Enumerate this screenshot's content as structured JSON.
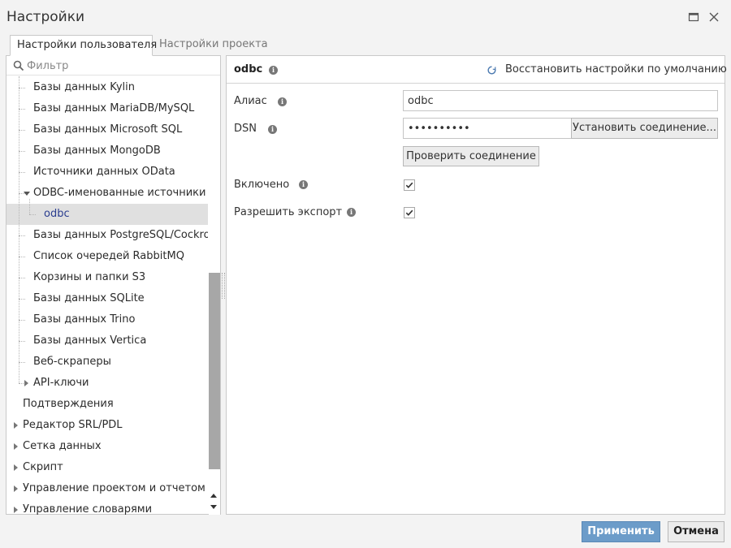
{
  "window": {
    "title": "Настройки",
    "maximize_icon": "maximize-icon",
    "close_icon": "close-icon"
  },
  "tabs": [
    {
      "label": "Настройки пользователя",
      "active": true
    },
    {
      "label": "Настройки проекта",
      "active": false
    }
  ],
  "filter": {
    "placeholder": "Фильтр",
    "icon": "search-icon"
  },
  "tree": {
    "items": [
      {
        "label": "Базы данных Kylin",
        "level": 2,
        "expander": "none"
      },
      {
        "label": "Базы данных MariaDB/MySQL",
        "level": 2,
        "expander": "none"
      },
      {
        "label": "Базы данных Microsoft SQL",
        "level": 2,
        "expander": "none"
      },
      {
        "label": "Базы данных MongoDB",
        "level": 2,
        "expander": "none"
      },
      {
        "label": "Источники данных OData",
        "level": 2,
        "expander": "none"
      },
      {
        "label": "ODBC-именованные источники",
        "level": 2,
        "expander": "expanded"
      },
      {
        "label": "odbc",
        "level": 3,
        "expander": "none",
        "selected": true
      },
      {
        "label": "Базы данных PostgreSQL/CockroachDB",
        "level": 2,
        "expander": "none"
      },
      {
        "label": "Список очередей RabbitMQ",
        "level": 2,
        "expander": "none"
      },
      {
        "label": "Корзины и папки S3",
        "level": 2,
        "expander": "none"
      },
      {
        "label": "Базы данных SQLite",
        "level": 2,
        "expander": "none"
      },
      {
        "label": "Базы данных Trino",
        "level": 2,
        "expander": "none"
      },
      {
        "label": "Базы данных Vertica",
        "level": 2,
        "expander": "none"
      },
      {
        "label": "Веб-скраперы",
        "level": 2,
        "expander": "none"
      },
      {
        "label": "API-ключи",
        "level": 2,
        "expander": "collapsed"
      },
      {
        "label": "Подтверждения",
        "level": 1,
        "expander": "none"
      },
      {
        "label": "Редактор SRL/PDL",
        "level": 1,
        "expander": "collapsed"
      },
      {
        "label": "Сетка данных",
        "level": 1,
        "expander": "collapsed"
      },
      {
        "label": "Скрипт",
        "level": 1,
        "expander": "collapsed"
      },
      {
        "label": "Управление проектом и отчетом",
        "level": 1,
        "expander": "collapsed"
      },
      {
        "label": "Управление словарями",
        "level": 1,
        "expander": "collapsed"
      }
    ]
  },
  "panel": {
    "title": "odbc",
    "restore_label": "Восстановить настройки по умолчанию",
    "restore_icon": "reset-icon",
    "info_icon": "info-icon"
  },
  "form": {
    "alias_label": "Алиас",
    "alias_value": "odbc",
    "dsn_label": "DSN",
    "dsn_value": "••••••••••",
    "connect_button": "Установить соединение...",
    "test_button": "Проверить соединение",
    "enabled_label": "Включено",
    "enabled_checked": true,
    "export_label": "Разрешить экспорт",
    "export_checked": true
  },
  "footer": {
    "apply_label": "Применить",
    "cancel_label": "Отмена",
    "accent_color": "#6c9cc9"
  }
}
